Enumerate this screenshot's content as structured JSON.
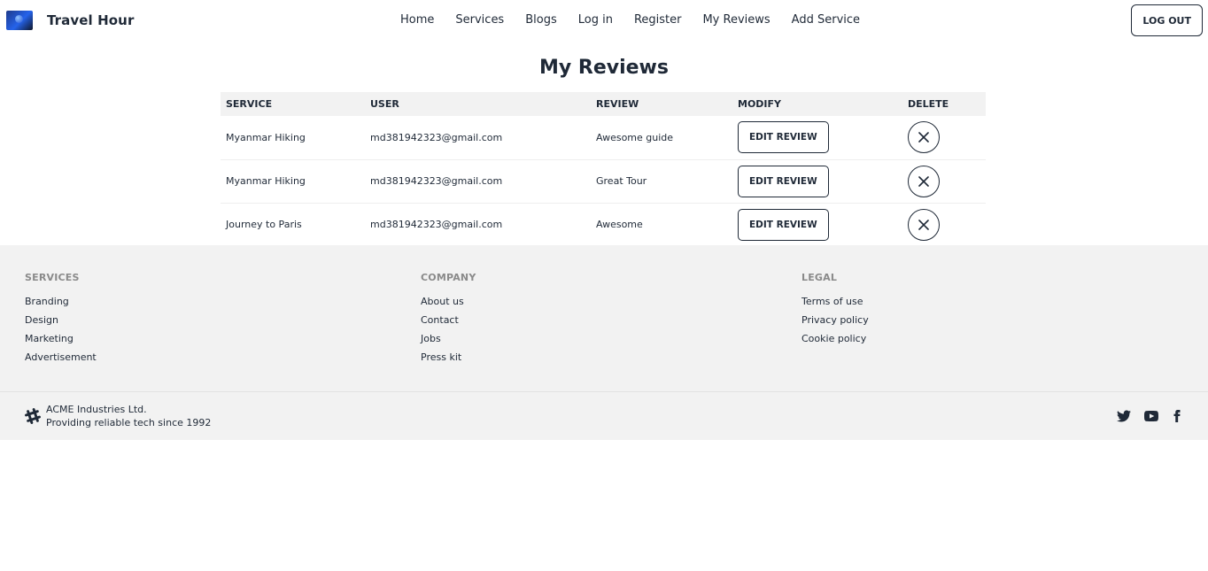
{
  "navbar": {
    "brand": "Travel Hour",
    "links": [
      "Home",
      "Services",
      "Blogs",
      "Log in",
      "Register",
      "My Reviews",
      "Add Service"
    ],
    "logout_label": "LOG OUT"
  },
  "page": {
    "title": "My Reviews"
  },
  "table": {
    "headers": [
      "SERVICE",
      "USER",
      "REVIEW",
      "MODIFY",
      "DELETE"
    ],
    "edit_label": "EDIT REVIEW",
    "rows": [
      {
        "service": "Myanmar Hiking",
        "user": "md381942323@gmail.com",
        "review": "Awesome guide"
      },
      {
        "service": "Myanmar Hiking",
        "user": "md381942323@gmail.com",
        "review": "Great Tour"
      },
      {
        "service": "Journey to Paris",
        "user": "md381942323@gmail.com",
        "review": "Awesome"
      }
    ]
  },
  "footer": {
    "services": {
      "title": "SERVICES",
      "links": [
        "Branding",
        "Design",
        "Marketing",
        "Advertisement"
      ]
    },
    "company": {
      "title": "COMPANY",
      "links": [
        "About us",
        "Contact",
        "Jobs",
        "Press kit"
      ]
    },
    "legal": {
      "title": "LEGAL",
      "links": [
        "Terms of use",
        "Privacy policy",
        "Cookie policy"
      ]
    },
    "company_name": "ACME Industries Ltd.",
    "tagline": "Providing reliable tech since 1992",
    "social_icons": [
      "twitter-icon",
      "youtube-icon",
      "facebook-icon"
    ]
  }
}
